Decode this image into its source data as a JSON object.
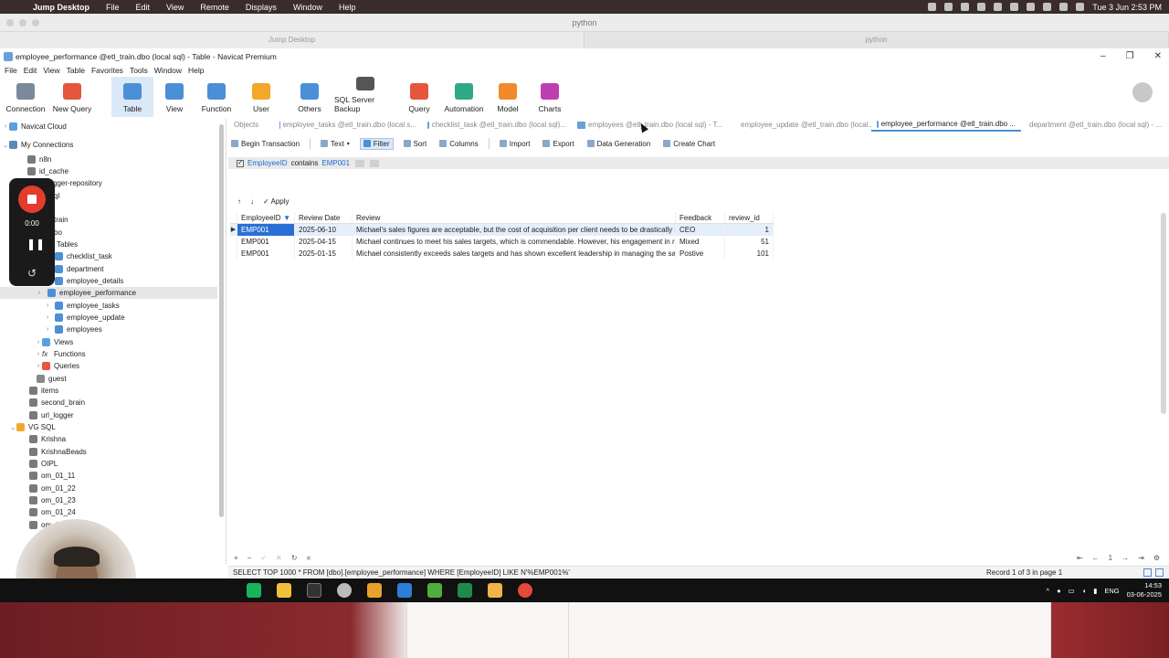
{
  "mac": {
    "menu": [
      "Jump Desktop",
      "File",
      "Edit",
      "View",
      "Remote",
      "Displays",
      "Window",
      "Help"
    ],
    "datetime": "Tue 3 Jun  2:53 PM",
    "window_title": "python",
    "tabs": [
      "Jump Desktop",
      "python"
    ]
  },
  "window": {
    "title": "employee_performance @etl_train.dbo (local sql) - Table - Navicat Premium",
    "menu": [
      "File",
      "Edit",
      "View",
      "Table",
      "Favorites",
      "Tools",
      "Window",
      "Help"
    ]
  },
  "toolbar": [
    {
      "label": "Connection",
      "icon": "connection-icon",
      "color": "#7a8a9a"
    },
    {
      "label": "New Query",
      "icon": "new-query-icon",
      "color": "#e4573d"
    },
    {
      "label": "Table",
      "icon": "table-icon",
      "color": "#4b8fd6"
    },
    {
      "label": "View",
      "icon": "view-icon",
      "color": "#4b8fd6"
    },
    {
      "label": "Function",
      "icon": "function-icon",
      "color": "#4b8fd6"
    },
    {
      "label": "User",
      "icon": "user-icon",
      "color": "#f3a72b"
    },
    {
      "label": "Others",
      "icon": "others-icon",
      "color": "#4b8fd6"
    },
    {
      "label": "SQL Server Backup",
      "icon": "backup-icon",
      "color": "#555"
    },
    {
      "label": "Query",
      "icon": "query-icon",
      "color": "#e4573d"
    },
    {
      "label": "Automation",
      "icon": "automation-icon",
      "color": "#2fa88a"
    },
    {
      "label": "Model",
      "icon": "model-icon",
      "color": "#f08a2b"
    },
    {
      "label": "Charts",
      "icon": "charts-icon",
      "color": "#c03fb0"
    }
  ],
  "sidebar": {
    "items": [
      {
        "label": "Navicat Cloud",
        "icon": "cloud-icon"
      },
      {
        "label": "My Connections",
        "icon": "connections-icon"
      },
      {
        "label": "n8n",
        "icon": "database-icon"
      },
      {
        "label": "id_cache",
        "icon": "database-icon"
      },
      {
        "label": "gger-repository",
        "icon": "database-icon"
      },
      {
        "label": "ql",
        "icon": "database-icon"
      },
      {
        "label": "train",
        "icon": "database-icon"
      },
      {
        "label": "bo",
        "icon": "schema-icon"
      },
      {
        "label": "Tables",
        "icon": "tables-folder-icon"
      },
      {
        "label": "checklist_task",
        "icon": "table-icon"
      },
      {
        "label": "department",
        "icon": "table-icon"
      },
      {
        "label": "employee_details",
        "icon": "table-icon"
      },
      {
        "label": "employee_performance",
        "icon": "table-icon"
      },
      {
        "label": "employee_tasks",
        "icon": "table-icon"
      },
      {
        "label": "employee_update",
        "icon": "table-icon"
      },
      {
        "label": "employees",
        "icon": "table-icon"
      },
      {
        "label": "Views",
        "icon": "views-icon"
      },
      {
        "label": "Functions",
        "icon": "functions-icon"
      },
      {
        "label": "Queries",
        "icon": "queries-icon"
      },
      {
        "label": "guest",
        "icon": "user-icon"
      },
      {
        "label": "items",
        "icon": "database-icon"
      },
      {
        "label": "second_brain",
        "icon": "database-icon"
      },
      {
        "label": "url_logger",
        "icon": "database-icon"
      },
      {
        "label": "VG SQL",
        "icon": "server-icon"
      },
      {
        "label": "Krishna",
        "icon": "database-icon"
      },
      {
        "label": "KrishnaBeads",
        "icon": "database-icon"
      },
      {
        "label": "OIPL",
        "icon": "database-icon"
      },
      {
        "label": "om_01_11",
        "icon": "database-icon"
      },
      {
        "label": "om_01_22",
        "icon": "database-icon"
      },
      {
        "label": "om_01_23",
        "icon": "database-icon"
      },
      {
        "label": "om_01_24",
        "icon": "database-icon"
      },
      {
        "label": "om_01_...",
        "icon": "database-icon"
      }
    ]
  },
  "recorder": {
    "time": "0:00"
  },
  "object_tabs": [
    "Objects",
    "employee_tasks @etl_train.dbo (local s...",
    "checklist_task @etl_train.dbo (local sql)...",
    "employees @etl_train.dbo (local sql) - T...",
    "employee_update @etl_train.dbo (local...",
    "employee_performance @etl_train.dbo ...",
    "department @etl_train.dbo (local sql) - ..."
  ],
  "sub_toolbar": [
    "Begin Transaction",
    "Text",
    "Filter",
    "Sort",
    "Columns",
    "Import",
    "Export",
    "Data Generation",
    "Create Chart"
  ],
  "filter": {
    "field": "EmployeeID",
    "operator": "contains",
    "value": "EMP001"
  },
  "apply_label": "Apply",
  "grid": {
    "columns": [
      "EmployeeID",
      "Review Date",
      "Review",
      "Feedback",
      "review_id"
    ],
    "rows": [
      [
        "EMP001",
        "2025-06-10",
        "Michael's sales figures are acceptable, but the cost of acquisition per client needs to be drastically r",
        "CEO",
        "1"
      ],
      [
        "EMP001",
        "2025-04-15",
        "Michael continues to meet his sales targets, which is commendable. However, his engagement in r",
        "Mixed",
        "51"
      ],
      [
        "EMP001",
        "2025-01-15",
        "Michael consistently exceeds sales targets and has shown excellent leadership in managing the sale",
        "Postive",
        "101"
      ]
    ]
  },
  "pagination": {
    "page": "1"
  },
  "status": {
    "sql": "SELECT TOP 1000 * FROM [dbo].[employee_performance] WHERE [EmployeeID] LIKE N'%EMP001%'",
    "record": "Record 1 of 3 in page 1"
  },
  "taskbar": {
    "lang": "ENG",
    "time": "14:53",
    "date": "03-06-2025"
  }
}
